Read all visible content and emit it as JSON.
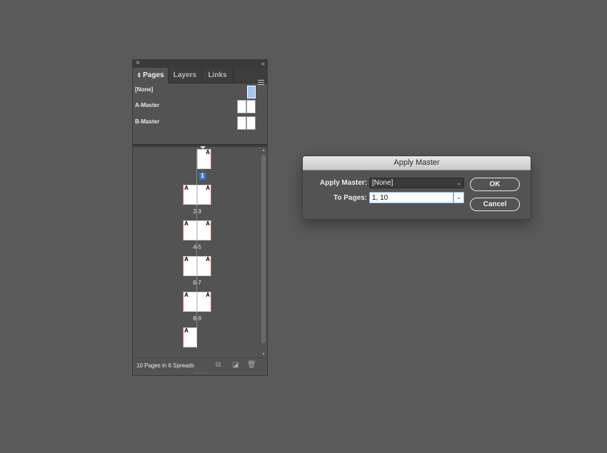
{
  "panel": {
    "close_glyph": "×",
    "collapse_glyph": "‹‹",
    "tabs": [
      {
        "label": "Pages",
        "arrow": "⇕",
        "active": true
      },
      {
        "label": "Layers",
        "active": false
      },
      {
        "label": "Links",
        "active": false
      }
    ],
    "menu_icon": "hamburger-icon",
    "masters": [
      {
        "label": "[None]"
      },
      {
        "label": "A-Master"
      },
      {
        "label": "B-Master"
      }
    ],
    "spreads": [
      {
        "label": "1",
        "pages": [
          {
            "letter": "A"
          }
        ]
      },
      {
        "label": "2-3",
        "pages": [
          {
            "letter": "A"
          },
          {
            "letter": "A"
          }
        ]
      },
      {
        "label": "4-5",
        "pages": [
          {
            "letter": "A"
          },
          {
            "letter": "A"
          }
        ]
      },
      {
        "label": "6-7",
        "pages": [
          {
            "letter": "A"
          },
          {
            "letter": "A"
          }
        ]
      },
      {
        "label": "8-9",
        "pages": [
          {
            "letter": "A"
          },
          {
            "letter": "A"
          }
        ]
      },
      {
        "label": "",
        "pages": [
          {
            "letter": "A"
          }
        ]
      }
    ],
    "footer_text": "10 Pages in 6 Spreads",
    "footer_icons": [
      "edit-page-size-icon",
      "new-page-icon",
      "trash-icon"
    ]
  },
  "dialog": {
    "title": "Apply Master",
    "apply_master_label": "Apply Master:",
    "apply_master_value": "[None]",
    "to_pages_label": "To Pages:",
    "to_pages_value": "1, 10",
    "ok_label": "OK",
    "cancel_label": "Cancel"
  },
  "colors": {
    "background": "#5a5a5a",
    "panel": "#535353",
    "selection_blue": "#2f7fd9",
    "none_master_blue": "#9fc6f5",
    "focus_ring": "#7db3ec"
  }
}
